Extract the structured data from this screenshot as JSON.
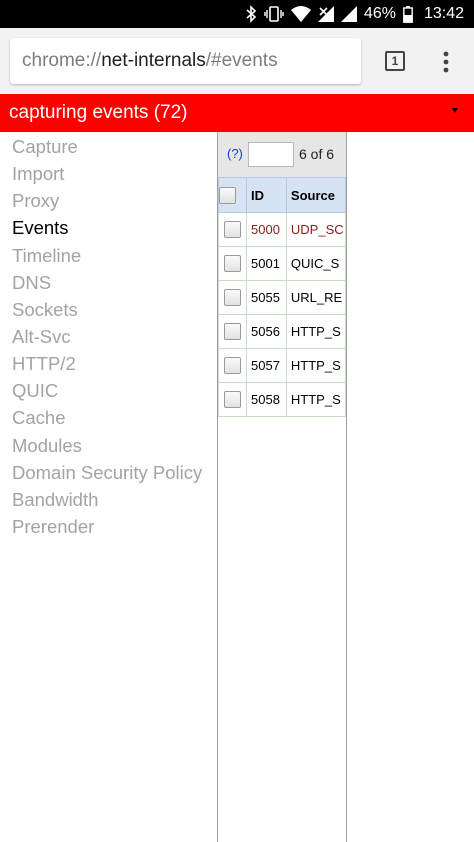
{
  "status_bar": {
    "battery_percent": "46%",
    "time": "13:42",
    "icons": [
      "bluetooth-icon",
      "vibrate-icon",
      "wifi-icon",
      "cell-signal-no-data-icon",
      "cell-signal-icon"
    ]
  },
  "browser": {
    "url_scheme": "chrome://",
    "url_host": "net-internals",
    "url_path": "/#events",
    "tab_count": "1",
    "menu_icon": "overflow-menu-icon"
  },
  "banner": {
    "status_text": "capturing events (72)",
    "color": "#ff0000"
  },
  "nav": {
    "items": [
      {
        "label": "Capture"
      },
      {
        "label": "Import"
      },
      {
        "label": "Proxy"
      },
      {
        "label": "Events",
        "selected": true
      },
      {
        "label": "Timeline"
      },
      {
        "label": "DNS"
      },
      {
        "label": "Sockets"
      },
      {
        "label": "Alt-Svc"
      },
      {
        "label": "HTTP/2"
      },
      {
        "label": "QUIC"
      },
      {
        "label": "Cache"
      },
      {
        "label": "Modules"
      },
      {
        "label": "Domain Security Policy"
      },
      {
        "label": "Bandwidth"
      },
      {
        "label": "Prerender"
      }
    ]
  },
  "events": {
    "help_link": "(?)",
    "filter_value": "",
    "count_text": "6 of 6",
    "columns": {
      "id": "ID",
      "source": "Source"
    },
    "rows": [
      {
        "id": "5000",
        "source": "UDP_SC",
        "error": true
      },
      {
        "id": "5001",
        "source": "QUIC_S",
        "error": false
      },
      {
        "id": "5055",
        "source": "URL_RE",
        "error": false
      },
      {
        "id": "5056",
        "source": "HTTP_S",
        "error": false
      },
      {
        "id": "5057",
        "source": "HTTP_S",
        "error": false
      },
      {
        "id": "5058",
        "source": "HTTP_S",
        "error": false
      }
    ]
  }
}
